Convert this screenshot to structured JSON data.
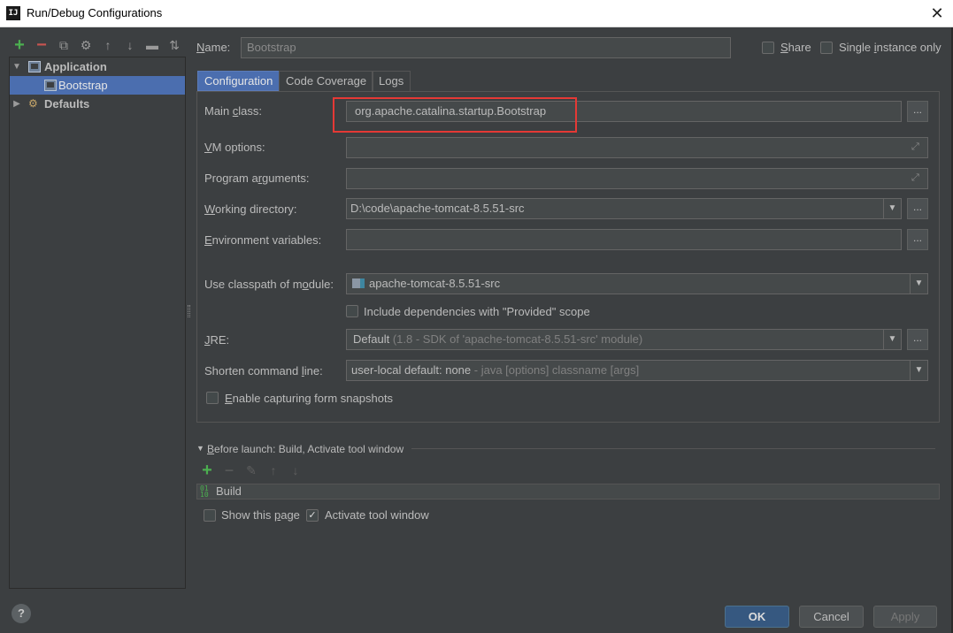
{
  "window": {
    "title": "Run/Debug Configurations",
    "app_icon": "IJ"
  },
  "tree": {
    "application": "Application",
    "bootstrap": "Bootstrap",
    "defaults": "Defaults"
  },
  "name": {
    "label_first": "N",
    "label_rest": "ame:",
    "value": "Bootstrap"
  },
  "share": {
    "label_first": "S",
    "label_rest": "hare"
  },
  "single_instance": {
    "label_pre": "Single ",
    "label_u": "i",
    "label_post": "nstance only"
  },
  "tabs": {
    "configuration": "Configuration",
    "code_coverage": "Code Coverage",
    "logs": "Logs"
  },
  "config": {
    "main_class_label": {
      "pre": "Main ",
      "u": "c",
      "post": "lass:"
    },
    "main_class_value": "org.apache.catalina.startup.Bootstrap",
    "vm_label": {
      "u": "V",
      "post": "M options:"
    },
    "prog_label": {
      "pre": "Program a",
      "u": "r",
      "post": "guments:"
    },
    "wd_label": {
      "u": "W",
      "post": "orking directory:"
    },
    "wd_value": "D:\\code\\apache-tomcat-8.5.51-src",
    "env_label": {
      "u": "E",
      "post": "nvironment variables:"
    },
    "classpath_label": {
      "pre": "Use classpath of m",
      "u": "o",
      "post": "dule:"
    },
    "classpath_value": "apache-tomcat-8.5.51-src",
    "include_deps": "Include dependencies with \"Provided\" scope",
    "jre_label": {
      "u": "J",
      "post": "RE:"
    },
    "jre_value_main": "Default",
    "jre_value_detail": "(1.8 - SDK of 'apache-tomcat-8.5.51-src' module)",
    "shorten_label": {
      "pre": "Shorten command ",
      "u": "l",
      "post": "ine:"
    },
    "shorten_value_main": "user-local default: none",
    "shorten_value_detail": " - java [options] classname [args]",
    "snapshots": {
      "u": "E",
      "post": "nable capturing form snapshots"
    }
  },
  "before_launch": {
    "pre": "",
    "u": "B",
    "post": "efore launch: Build, Activate tool window",
    "build_item": "Build"
  },
  "show_page": {
    "pre": "Show this ",
    "u": "p",
    "post": "age"
  },
  "activate_tool": "Activate tool window",
  "buttons": {
    "ok": "OK",
    "cancel": "Cancel",
    "apply": "Apply",
    "dots": "..."
  },
  "colors": {
    "accent": "#4b6eaf",
    "highlight": "#e53935",
    "add": "#4caf50",
    "remove": "#c75450"
  }
}
